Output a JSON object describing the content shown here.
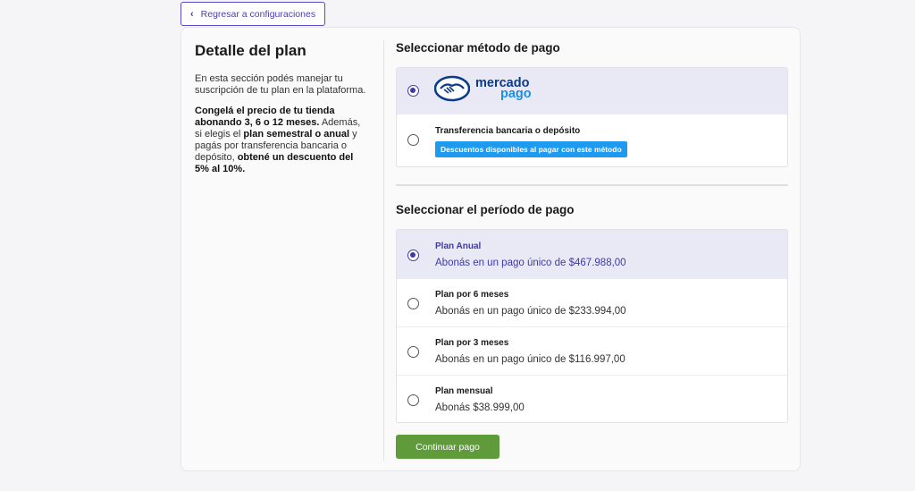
{
  "back_button": {
    "label": "Regresar a configuraciones",
    "icon": "chevron-left-icon"
  },
  "plan_detail": {
    "title": "Detalle del plan",
    "intro": "En esta sección podés manejar tu suscripción de tu plan en la plataforma.",
    "promo": {
      "b1": "Congelá el precio de tu tienda abonando 3, 6 o 12 meses.",
      "t1": " Además, si elegis el ",
      "b2": "plan semestral o anual",
      "t2": " y pagás por transferencia bancaria o depósito, ",
      "b3": "obtené un descuento del 5% al 10%."
    }
  },
  "payment_method": {
    "title": "Seleccionar método de pago",
    "options": [
      {
        "logo_line1": "mercado",
        "logo_line2": "pago",
        "selected": true
      },
      {
        "label": "Transferencia bancaria o depósito",
        "badge": "Descuentos disponibles al pagar con este método",
        "selected": false
      }
    ]
  },
  "payment_period": {
    "title": "Seleccionar el período de pago",
    "options": [
      {
        "title": "Plan Anual",
        "subtitle": "Abonás en un pago único de $467.988,00",
        "selected": true
      },
      {
        "title": "Plan por 6 meses",
        "subtitle": "Abonás en un pago único de $233.994,00",
        "selected": false
      },
      {
        "title": "Plan por 3 meses",
        "subtitle": "Abonás en un pago único de $116.997,00",
        "selected": false
      },
      {
        "title": "Plan mensual",
        "subtitle": "Abonás $38.999,00",
        "selected": false
      }
    ]
  },
  "continue_button": {
    "label": "Continuar pago"
  },
  "colors": {
    "accent": "#3f3aa8",
    "continue": "#5f9a3b",
    "badge": "#1e9bf0",
    "selected_bg": "#e8e9f5"
  }
}
